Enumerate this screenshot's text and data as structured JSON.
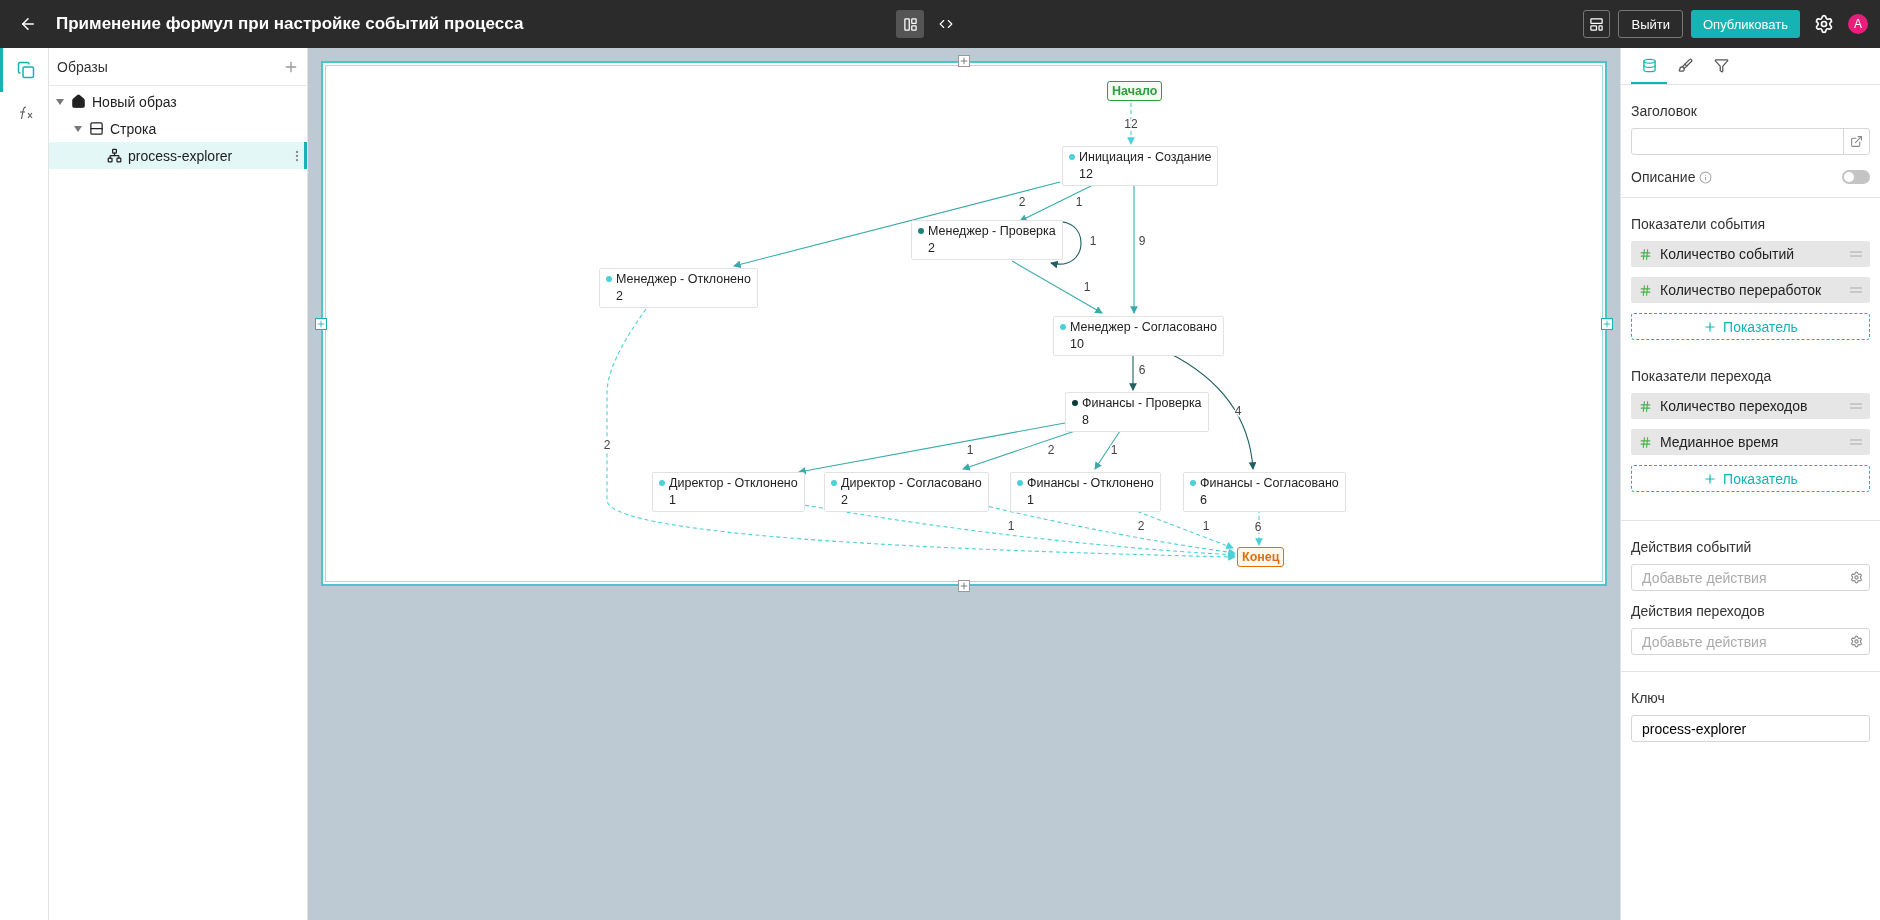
{
  "topbar": {
    "title": "Применение формул при настройке событий процесса",
    "view_toggles": [
      {
        "kind": "layout",
        "selected": true
      },
      {
        "kind": "code",
        "selected": false
      }
    ],
    "exit_button": "Выйти",
    "publish_button": "Опубликовать",
    "avatar": "A"
  },
  "rail": [
    {
      "kind": "pages",
      "selected": true
    },
    {
      "kind": "formula",
      "selected": false
    }
  ],
  "tree": {
    "title": "Образы",
    "items": [
      {
        "label": "Новый образ",
        "kind": "home",
        "expanded": true,
        "selected": false,
        "children": [
          {
            "label": "Строка",
            "kind": "row",
            "expanded": true,
            "selected": false,
            "children": [
              {
                "label": "process-explorer",
                "kind": "process",
                "selected": true
              }
            ]
          }
        ]
      }
    ]
  },
  "diagram": {
    "nodes": [
      {
        "kind": "start",
        "title": "Начало"
      },
      {
        "kind": "event",
        "title": "Инициация - Создание",
        "count": "12",
        "color": "#4dd0d8"
      },
      {
        "kind": "event",
        "title": "Менеджер - Проверка",
        "count": "2",
        "color": "#1f7f80"
      },
      {
        "kind": "event",
        "title": "Менеджер - Отклонено",
        "count": "2",
        "color": "#4dd0d8"
      },
      {
        "kind": "event",
        "title": "Менеджер - Согласовано",
        "count": "10",
        "color": "#4dd0d8"
      },
      {
        "kind": "event",
        "title": "Финансы - Проверка",
        "count": "8",
        "color": "#0d3b3b"
      },
      {
        "kind": "event",
        "title": "Директор - Отклонено",
        "count": "1",
        "color": "#4dd0d8"
      },
      {
        "kind": "event",
        "title": "Директор - Согласовано",
        "count": "2",
        "color": "#4dd0d8"
      },
      {
        "kind": "event",
        "title": "Финансы - Отклонено",
        "count": "1",
        "color": "#4dd0d8"
      },
      {
        "kind": "event",
        "title": "Финансы - Согласовано",
        "count": "6",
        "color": "#4dd0d8"
      },
      {
        "kind": "end",
        "title": "Конец"
      }
    ],
    "edges": [
      {
        "label": "12",
        "kind": "dashed",
        "color": "#4dd0d8"
      },
      {
        "label": "2",
        "kind": "solid",
        "color": "#3aabab"
      },
      {
        "label": "1",
        "kind": "solid",
        "color": "#3aabab"
      },
      {
        "label": "9",
        "kind": "solid",
        "color": "#3aabab"
      },
      {
        "label": "1",
        "kind": "solid",
        "color": "#1f5f60"
      },
      {
        "label": "1",
        "kind": "solid",
        "color": "#3aabab"
      },
      {
        "label": "6",
        "kind": "solid",
        "color": "#1f5f60"
      },
      {
        "label": "4",
        "kind": "solid",
        "color": "#1f5f60"
      },
      {
        "label": "1",
        "kind": "solid",
        "color": "#3aabab"
      },
      {
        "label": "2",
        "kind": "solid",
        "color": "#3aabab"
      },
      {
        "label": "1",
        "kind": "solid",
        "color": "#3aabab"
      },
      {
        "label": "2",
        "kind": "dashed",
        "color": "#4dd0d8"
      },
      {
        "label": "1",
        "kind": "dashed",
        "color": "#4dd0d8"
      },
      {
        "label": "2",
        "kind": "dashed",
        "color": "#4dd0d8"
      },
      {
        "label": "1",
        "kind": "dashed",
        "color": "#4dd0d8"
      },
      {
        "label": "6",
        "kind": "dashed",
        "color": "#4dd0d8"
      }
    ]
  },
  "panel": {
    "tabs": [
      {
        "kind": "data",
        "selected": true
      },
      {
        "kind": "style",
        "selected": false
      },
      {
        "kind": "filter",
        "selected": false
      }
    ],
    "title_label": "Заголовок",
    "description_label": "Описание",
    "description_on": false,
    "metric_groups": [
      {
        "label": "Показатели события",
        "items": [
          "Количество событий",
          "Количество переработок"
        ],
        "add": "Показатель"
      },
      {
        "label": "Показатели перехода",
        "items": [
          "Количество переходов",
          "Медианное время"
        ],
        "add": "Показатель"
      }
    ],
    "actions": [
      {
        "label": "Действия событий",
        "placeholder": "Добавьте действия"
      },
      {
        "label": "Действия переходов",
        "placeholder": "Добавьте действия"
      }
    ],
    "key_label": "Ключ",
    "key_value": "process-explorer"
  }
}
